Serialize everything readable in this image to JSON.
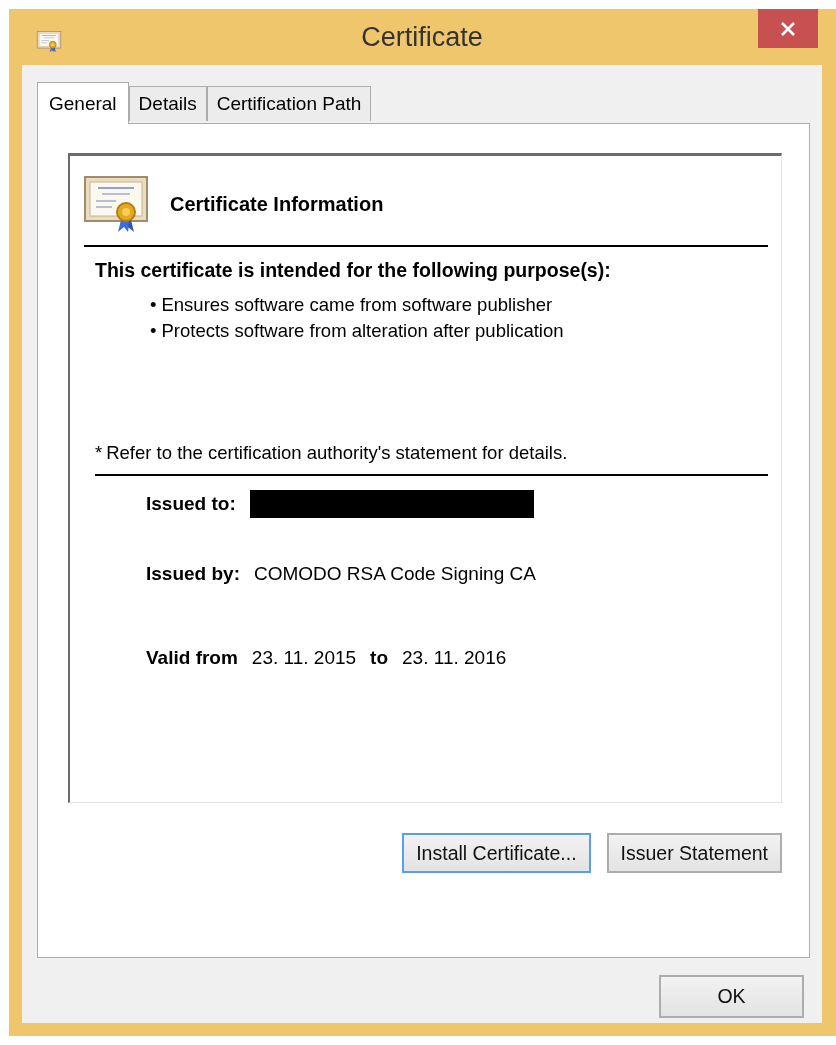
{
  "window": {
    "title": "Certificate"
  },
  "tabs": [
    {
      "label": "General",
      "selected": true
    },
    {
      "label": "Details",
      "selected": false
    },
    {
      "label": "Certification Path",
      "selected": false
    }
  ],
  "general": {
    "heading": "Certificate Information",
    "purpose_title": "This certificate is intended for the following purpose(s):",
    "purposes": [
      {
        "bullet": "•",
        "text": "Ensures software came from software publisher"
      },
      {
        "bullet": "•",
        "text": "Protects software from alteration after publication"
      }
    ],
    "note": {
      "mark": "*",
      "text": "Refer to the certification authority's statement for details."
    },
    "issued_to": {
      "label": "Issued to:",
      "redacted": true
    },
    "issued_by": {
      "label": "Issued by:",
      "value": "COMODO RSA Code Signing CA"
    },
    "valid": {
      "from_label": "Valid from",
      "from": "23. 11. 2015",
      "to_label": "to",
      "to": "23. 11. 2016"
    },
    "buttons": [
      {
        "label": "Install Certificate...",
        "focused": true
      },
      {
        "label": "Issuer Statement",
        "focused": false
      }
    ]
  },
  "footer_buttons": [
    {
      "label": "OK",
      "focused": false
    }
  ]
}
